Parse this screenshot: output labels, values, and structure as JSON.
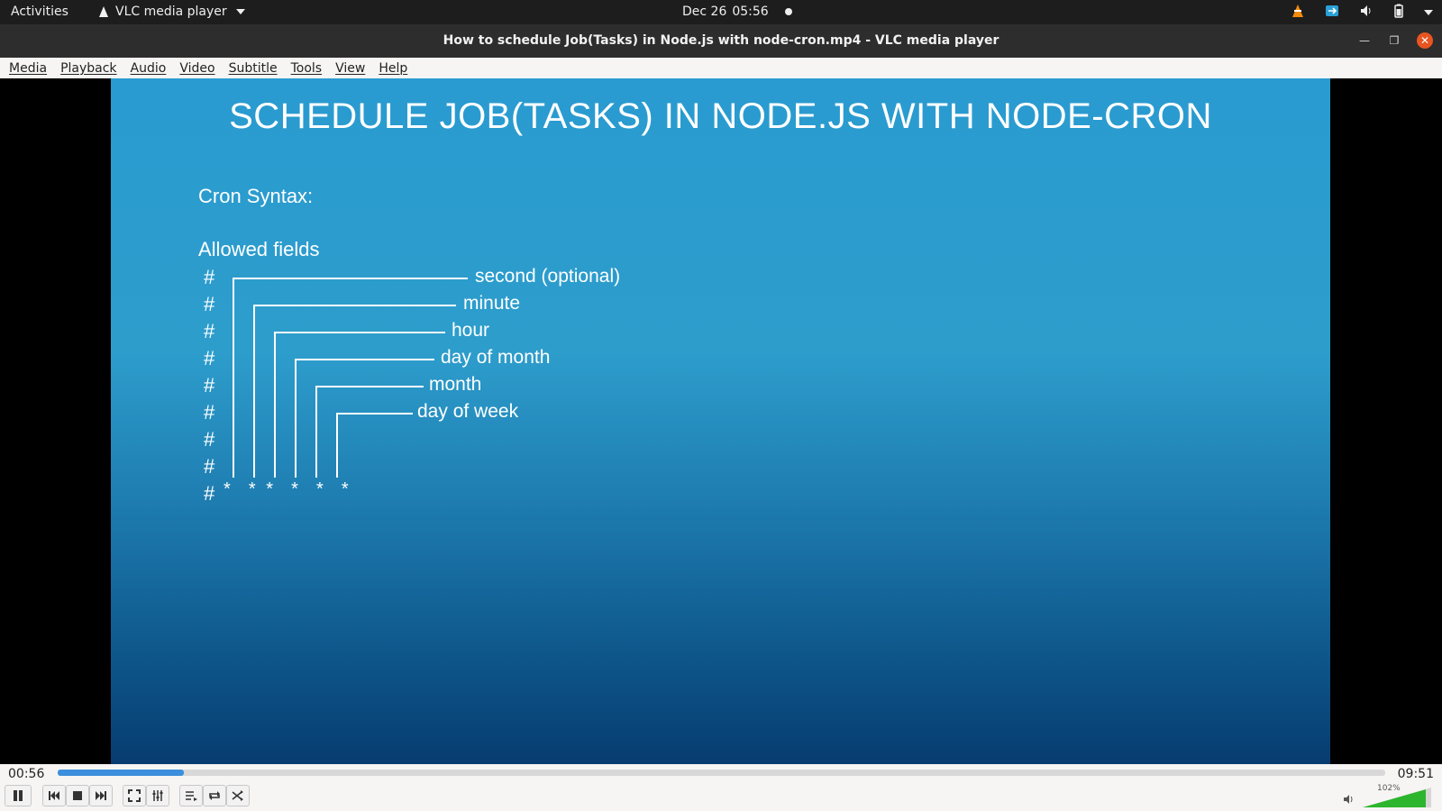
{
  "topbar": {
    "activities": "Activities",
    "app_name": "VLC media player",
    "date": "Dec 26",
    "time": "05:56"
  },
  "window": {
    "title": "How to schedule Job(Tasks) in Node.js with node-cron.mp4 - VLC media player"
  },
  "menu": [
    "Media",
    "Playback",
    "Audio",
    "Video",
    "Subtitle",
    "Tools",
    "View",
    "Help"
  ],
  "slide": {
    "title": "SCHEDULE JOB(TASKS) IN NODE.JS WITH NODE-CRON",
    "cron_syntax": "Cron Syntax:",
    "allowed_fields": "Allowed fields",
    "fields": [
      "second (optional)",
      "minute",
      "hour",
      "day of month",
      "month",
      "day of week"
    ],
    "hash": "#",
    "stars": "*  * *  *  *  *"
  },
  "playback": {
    "elapsed": "00:56",
    "total": "09:51",
    "progress_fraction": 0.095,
    "volume": "102%"
  },
  "icons": [
    "vlc-cone-icon",
    "network-icon",
    "volume-icon",
    "battery-icon",
    "minimize-icon",
    "maximize-icon",
    "close-icon"
  ]
}
